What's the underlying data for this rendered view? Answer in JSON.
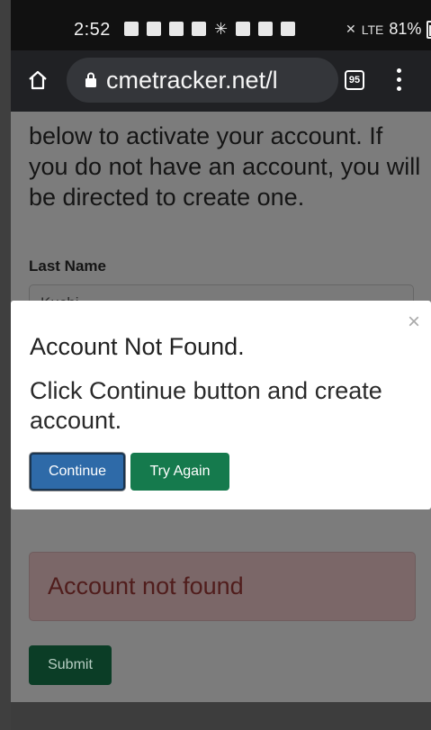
{
  "status_bar": {
    "time": "2:52",
    "battery_percent": "81%",
    "network": "LTE"
  },
  "browser": {
    "url": "cmetracker.net/l",
    "tab_count": "95"
  },
  "page": {
    "intro_text": "below to activate your account. If you do not have an account, you will be directed to create one.",
    "last_name_label": "Last Name",
    "last_name_value": "Kuchi...",
    "alert_text": "Account not found",
    "submit_label": "Submit"
  },
  "modal": {
    "title": "Account Not Found.",
    "message": "Click Continue button and create account.",
    "close_symbol": "×",
    "continue_label": "Continue",
    "try_again_label": "Try Again"
  },
  "colors": {
    "continue_button": "#2e6aa8",
    "try_again_button": "#157a4d",
    "submit_button": "#0b3d26",
    "alert_bg": "#f2dede"
  }
}
